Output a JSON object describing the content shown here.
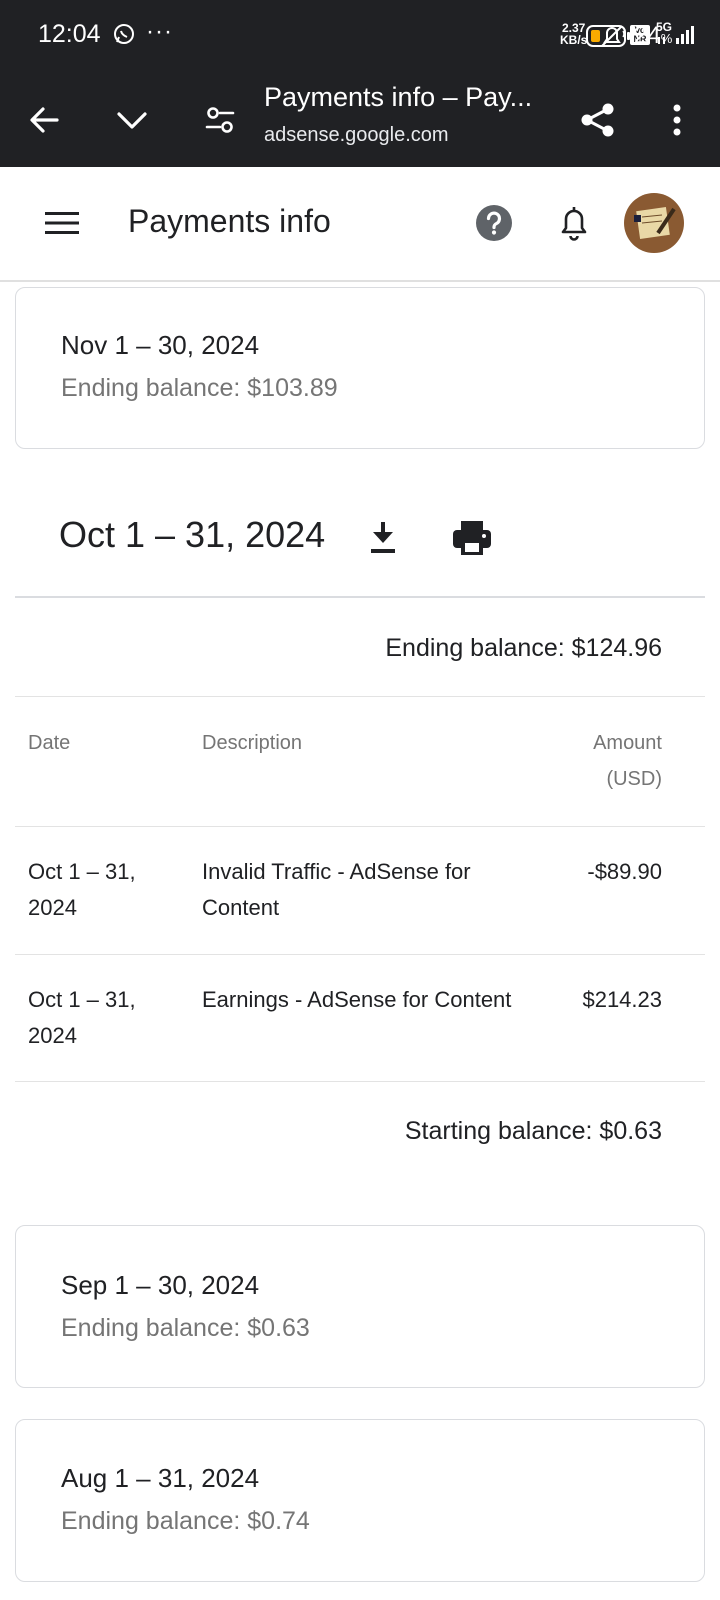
{
  "status_bar": {
    "time": "12:04",
    "more": "···",
    "net_speed_value": "2.37",
    "net_speed_unit": "KB/s",
    "volte_label_top": "Vo",
    "volte_label_bottom": "NR",
    "network": "5G",
    "battery_percent": "24",
    "battery_percent_sign": "%",
    "icons": [
      "whatsapp-icon",
      "mute-bell-icon",
      "volte-icon",
      "signal-icon",
      "battery-icon"
    ]
  },
  "browser": {
    "page_title": "Payments info – Pay...",
    "url": "adsense.google.com",
    "icons": [
      "back-arrow-icon",
      "chevron-down-icon",
      "site-settings-icon",
      "share-icon",
      "more-vert-icon"
    ]
  },
  "app_bar": {
    "title": "Payments info",
    "icons": [
      "menu-icon",
      "help-icon",
      "notifications-icon",
      "avatar"
    ]
  },
  "periods": {
    "nov": {
      "period": "Nov 1 – 30, 2024",
      "ending_balance": "Ending balance: $103.89"
    },
    "oct": {
      "period": "Oct 1 – 31, 2024",
      "ending_balance": "Ending balance: $124.96",
      "starting_balance": "Starting balance: $0.63",
      "table": {
        "headers": {
          "date": "Date",
          "description": "Description",
          "amount_line1": "Amount",
          "amount_line2": "(USD)"
        },
        "rows": [
          {
            "date_line1": "Oct 1 – 31,",
            "date_line2": "2024",
            "desc_line1": "Invalid Traffic - AdSense for",
            "desc_line2": "Content",
            "amount": "-$89.90"
          },
          {
            "date_line1": "Oct 1 – 31,",
            "date_line2": "2024",
            "desc_line1": "Earnings - AdSense for Content",
            "desc_line2": "",
            "amount": "$214.23"
          }
        ]
      }
    },
    "sep": {
      "period": "Sep 1 – 30, 2024",
      "ending_balance": "Ending balance: $0.63"
    },
    "aug": {
      "period": "Aug 1 – 31, 2024",
      "ending_balance": "Ending balance: $0.74"
    }
  },
  "colors": {
    "chrome_dark": "#202124",
    "text_primary": "#202124",
    "text_secondary": "#757575",
    "divider": "#dadce0",
    "battery_fill": "#f9ab00"
  }
}
